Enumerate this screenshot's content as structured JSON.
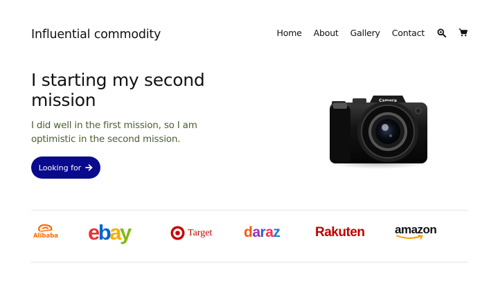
{
  "header": {
    "brand": "Influential commodity",
    "nav": [
      "Home",
      "About",
      "Gallery",
      "Contact"
    ],
    "icons": [
      "search-icon",
      "cart-icon"
    ]
  },
  "hero": {
    "title": "I starting my second mission",
    "subtitle": "I did well in the first mission, so I am optimistic in the second mission.",
    "cta_label": "Looking for",
    "camera_label": "Camera"
  },
  "partners": {
    "alibaba": "Alibaba",
    "ebay": [
      "e",
      "b",
      "a",
      "y"
    ],
    "target": "Target",
    "daraz": [
      "d",
      "a",
      "r",
      "a",
      "z"
    ],
    "rakuten": "Rakuten",
    "amazon": "amazon"
  },
  "colors": {
    "cta_background": "#0a0a8c",
    "subtitle": "#4b5d2f",
    "ebay": [
      "#e53238",
      "#0064d2",
      "#f5af02",
      "#86b817"
    ],
    "daraz": [
      "#f85606",
      "#9c2fb5",
      "#2f5fd6",
      "#ff2d55",
      "#1a7ad9"
    ],
    "alibaba": "#ff6a00",
    "target": "#cc0000",
    "rakuten": "#bf0000",
    "amazon_smile": "#ff9900"
  }
}
